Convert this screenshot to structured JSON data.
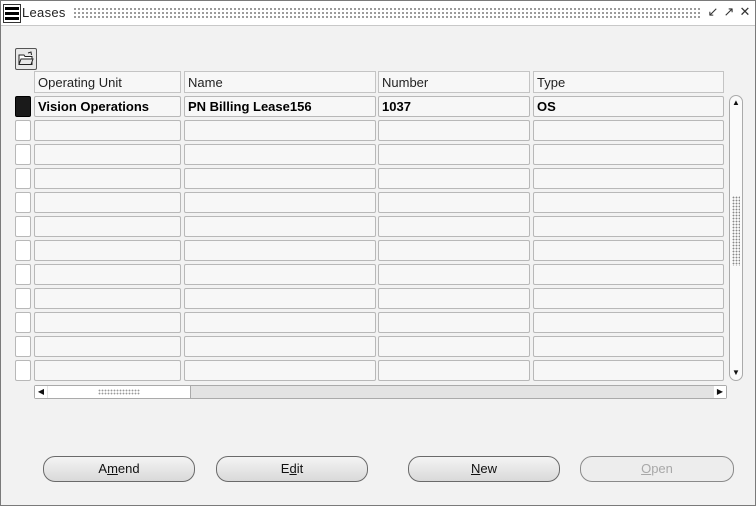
{
  "window": {
    "title": "Leases",
    "controls": [
      "minimize",
      "maximize",
      "close"
    ]
  },
  "toolbar": {
    "folder_icon": "folder-open-icon"
  },
  "table": {
    "columns": [
      "Operating Unit",
      "Name",
      "Number",
      "Type"
    ],
    "rows": [
      {
        "operating_unit": "Vision Operations",
        "name": "PN Billing Lease156",
        "number": "1037",
        "type": "OS",
        "current": true
      },
      {
        "operating_unit": "",
        "name": "",
        "number": "",
        "type": ""
      },
      {
        "operating_unit": "",
        "name": "",
        "number": "",
        "type": ""
      },
      {
        "operating_unit": "",
        "name": "",
        "number": "",
        "type": ""
      },
      {
        "operating_unit": "",
        "name": "",
        "number": "",
        "type": ""
      },
      {
        "operating_unit": "",
        "name": "",
        "number": "",
        "type": ""
      },
      {
        "operating_unit": "",
        "name": "",
        "number": "",
        "type": ""
      },
      {
        "operating_unit": "",
        "name": "",
        "number": "",
        "type": ""
      },
      {
        "operating_unit": "",
        "name": "",
        "number": "",
        "type": ""
      },
      {
        "operating_unit": "",
        "name": "",
        "number": "",
        "type": ""
      },
      {
        "operating_unit": "",
        "name": "",
        "number": "",
        "type": ""
      },
      {
        "operating_unit": "",
        "name": "",
        "number": "",
        "type": ""
      }
    ]
  },
  "buttons": {
    "amend": {
      "pre": "A",
      "mnemonic": "m",
      "post": "end"
    },
    "edit": {
      "pre": "E",
      "mnemonic": "d",
      "post": "it"
    },
    "new": {
      "pre": "",
      "mnemonic": "N",
      "post": "ew"
    },
    "open": {
      "pre": "",
      "mnemonic": "O",
      "post": "pen",
      "enabled": false
    }
  }
}
